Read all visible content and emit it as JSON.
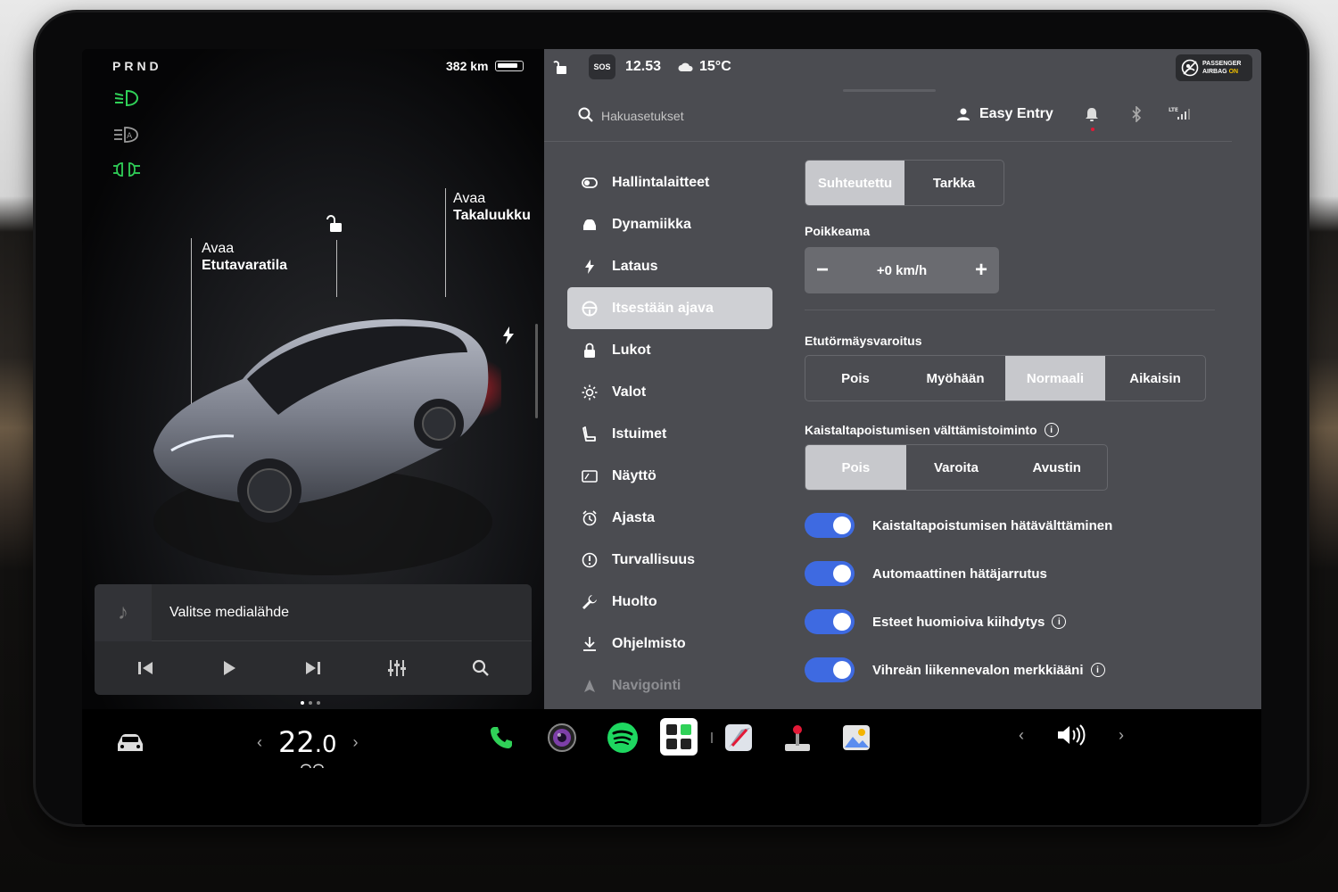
{
  "left": {
    "gear": "PRND",
    "range": "382 km",
    "labels": {
      "frunk_title": "Avaa",
      "frunk_sub": "Etutavaratila",
      "trunk_title": "Avaa",
      "trunk_sub": "Takaluukku"
    },
    "media": {
      "title": "Valitse medialähde"
    }
  },
  "status": {
    "sos": "SOS",
    "time": "12.53",
    "temperature": "15°C",
    "airbag_line1": "PASSENGER",
    "airbag_line2a": "AIRBAG",
    "airbag_line2b": "ON"
  },
  "topbar": {
    "search_placeholder": "Hakuasetukset",
    "profile": "Easy Entry",
    "lte": "LTE"
  },
  "menu": [
    {
      "label": "Hallintalaitteet",
      "icon": "toggle-icon"
    },
    {
      "label": "Dynamiikka",
      "icon": "car-icon"
    },
    {
      "label": "Lataus",
      "icon": "bolt-icon"
    },
    {
      "label": "Itsestään ajava",
      "icon": "steering-wheel-icon",
      "active": true
    },
    {
      "label": "Lukot",
      "icon": "lock-icon"
    },
    {
      "label": "Valot",
      "icon": "sun-icon"
    },
    {
      "label": "Istuimet",
      "icon": "seat-icon"
    },
    {
      "label": "Näyttö",
      "icon": "display-icon"
    },
    {
      "label": "Ajasta",
      "icon": "alarm-clock-icon"
    },
    {
      "label": "Turvallisuus",
      "icon": "info-circle-icon"
    },
    {
      "label": "Huolto",
      "icon": "wrench-icon"
    },
    {
      "label": "Ohjelmisto",
      "icon": "download-icon"
    },
    {
      "label": "Navigointi",
      "icon": "navigation-icon"
    }
  ],
  "settings": {
    "speed_mode": {
      "options": [
        "Suhteutettu",
        "Tarkka"
      ],
      "selected": 0
    },
    "offset_label": "Poikkeama",
    "offset_value": "+0 km/h",
    "fcw_label": "Etutörmäysvaroitus",
    "fcw": {
      "options": [
        "Pois",
        "Myöhään",
        "Normaali",
        "Aikaisin"
      ],
      "selected": 2
    },
    "lane_label": "Kaistaltapoistumisen välttämistoiminto",
    "lane": {
      "options": [
        "Pois",
        "Varoita",
        "Avustin"
      ],
      "selected": 0
    },
    "toggles": [
      {
        "label": "Kaistaltapoistumisen hätävälttäminen",
        "on": true,
        "info": false
      },
      {
        "label": "Automaattinen hätäjarrutus",
        "on": true,
        "info": false
      },
      {
        "label": "Esteet huomioiva kiihdytys",
        "on": true,
        "info": true
      },
      {
        "label": "Vihreän liikennevalon merkkiääni",
        "on": true,
        "info": true
      }
    ]
  },
  "dock": {
    "temp_int": "22",
    "temp_dec": ".0"
  },
  "colors": {
    "accent": "#3e6ae1",
    "panel": "#4b4c51",
    "green_light": "#30d158"
  }
}
